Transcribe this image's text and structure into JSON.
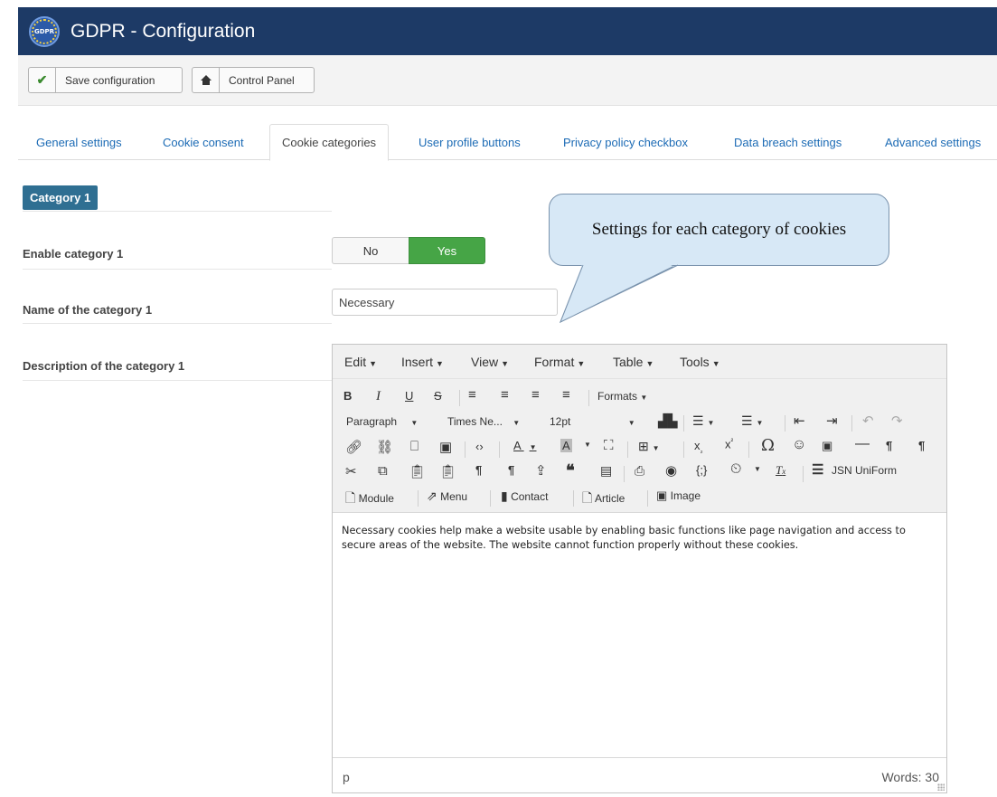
{
  "header": {
    "title": "GDPR - Configuration",
    "logo_text": "GDPR"
  },
  "toolbar": {
    "save_label": "Save configuration",
    "control_panel_label": "Control Panel"
  },
  "tabs": [
    {
      "label": "General settings"
    },
    {
      "label": "Cookie consent"
    },
    {
      "label": "Cookie categories"
    },
    {
      "label": "User profile buttons"
    },
    {
      "label": "Privacy policy checkbox"
    },
    {
      "label": "Data breach settings"
    },
    {
      "label": "Advanced settings"
    }
  ],
  "active_tab": "Cookie categories",
  "category": {
    "badge": "Category 1",
    "enable_label": "Enable category 1",
    "toggle": {
      "no": "No",
      "yes": "Yes",
      "selected": "Yes"
    },
    "name_label": "Name of the category 1",
    "name_value": "Necessary",
    "description_label": "Description of the category 1"
  },
  "callout": {
    "text": "Settings for each category of cookies"
  },
  "editor": {
    "menus": [
      "Edit",
      "Insert",
      "View",
      "Format",
      "Table",
      "Tools"
    ],
    "formats_label": "Formats",
    "block_format": "Paragraph",
    "font_family": "Times Ne...",
    "font_size": "12pt",
    "plugin_label": "JSN UniForm",
    "insert_buttons": [
      "Module",
      "Menu",
      "Contact",
      "Article",
      "Image"
    ],
    "content": "Necessary cookies help make a website usable by enabling basic functions like page navigation and access to secure areas of the website. The website cannot function properly without these cookies.",
    "path": "p",
    "word_count": "Words: 30"
  },
  "colors": {
    "header_bg": "#1d3a66",
    "badge_bg": "#2f6f92",
    "yes_green": "#46a546",
    "tab_link": "#1c6bb5",
    "callout_bg": "#d7e8f6"
  }
}
